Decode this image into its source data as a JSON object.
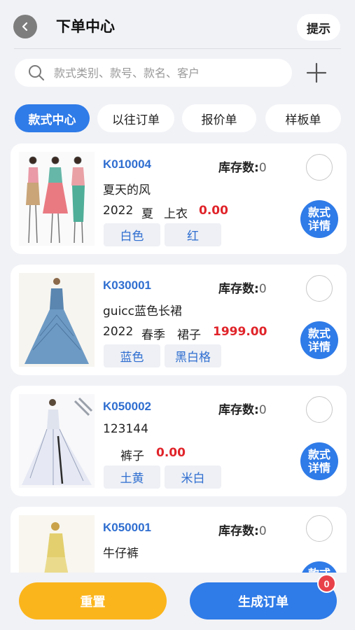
{
  "header": {
    "title": "下单中心",
    "hint_label": "提示"
  },
  "search": {
    "placeholder": "款式类别、款号、款名、客户",
    "value": ""
  },
  "tabs": [
    {
      "label": "款式中心",
      "active": true
    },
    {
      "label": "以往订单",
      "active": false
    },
    {
      "label": "报价单",
      "active": false
    },
    {
      "label": "样板单",
      "active": false
    }
  ],
  "products": [
    {
      "code": "K010004",
      "stock_label": "库存数:",
      "stock": "0",
      "name": "夏天的风",
      "year": "2022",
      "season": "夏",
      "category": "上衣",
      "price": "0.00",
      "colors": [
        "白色",
        "红"
      ],
      "detail_line1": "款式",
      "detail_line2": "详情",
      "image": "three-women-sketch"
    },
    {
      "code": "K030001",
      "stock_label": "库存数:",
      "stock": "0",
      "name": "guicc蓝色长裙",
      "year": "2022",
      "season": "春季",
      "category": "裙子",
      "price": "1999.00",
      "colors": [
        "蓝色",
        "黑白格"
      ],
      "detail_line1": "款式",
      "detail_line2": "详情",
      "image": "blue-gown-sketch"
    },
    {
      "code": "K050002",
      "stock_label": "库存数:",
      "stock": "0",
      "name": "123144",
      "year": "",
      "season": "",
      "category": "裤子",
      "price": "0.00",
      "colors": [
        "土黄",
        "米白"
      ],
      "detail_line1": "款式",
      "detail_line2": "详情",
      "image": "white-gown-sketch"
    },
    {
      "code": "K050001",
      "stock_label": "库存数:",
      "stock": "0",
      "name": "牛仔裤",
      "detail_line1": "款式",
      "detail_line2": "详情",
      "image": "yellow-dress-sketch"
    }
  ],
  "bottom": {
    "reset_label": "重置",
    "order_label": "生成订单",
    "order_count": "0"
  },
  "colors": {
    "accent": "#2f7be8",
    "code_blue": "#2f6ed0",
    "price_red": "#e0242a",
    "reset_yellow": "#fbb51c",
    "badge_red": "#e8414a",
    "background": "#f1f2f6"
  },
  "icons": [
    "back-icon",
    "search-icon",
    "add-icon"
  ]
}
